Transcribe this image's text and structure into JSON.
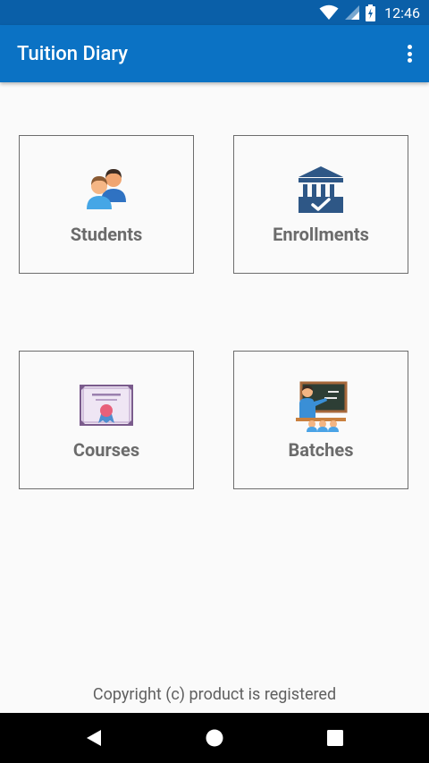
{
  "status_bar": {
    "time": "12:46",
    "icons": [
      "wifi-icon",
      "signal-icon",
      "battery-icon"
    ]
  },
  "app_bar": {
    "title": "Tuition Diary",
    "menu_icon": "more-vert-icon",
    "background": "#0b72c4"
  },
  "tiles": [
    {
      "label": "Students",
      "icon": "students-icon"
    },
    {
      "label": "Enrollments",
      "icon": "enrollments-icon"
    },
    {
      "label": "Courses",
      "icon": "courses-icon"
    },
    {
      "label": "Batches",
      "icon": "batches-icon"
    }
  ],
  "footer": {
    "text": "Copyright (c) product is registered"
  },
  "nav_bar": {
    "buttons": [
      "back-icon",
      "home-icon",
      "recents-icon"
    ]
  }
}
